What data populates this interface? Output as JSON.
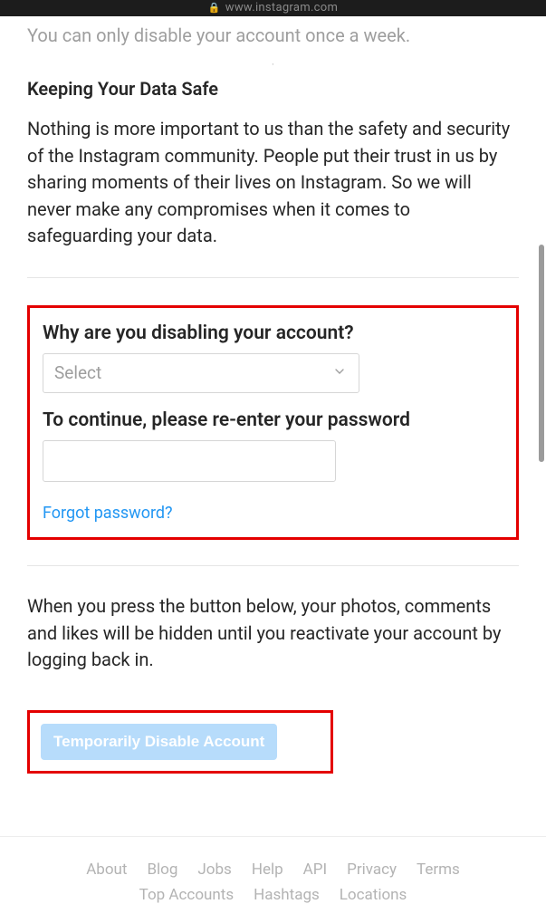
{
  "topbar": {
    "url": "www.instagram.com"
  },
  "intro": {
    "truncated_text": "You can only disable your account once a week."
  },
  "safe": {
    "title": "Keeping Your Data Safe",
    "body": "Nothing is more important to us than the safety and security of the Instagram community. People put their trust in us by sharing moments of their lives on Instagram. So we will never make any compromises when it comes to safeguarding your data."
  },
  "form": {
    "reason_label": "Why are you disabling your account?",
    "select_value": "Select",
    "password_label": "To continue, please re-enter your password",
    "password_value": "",
    "forgot_link": "Forgot password?"
  },
  "confirm": {
    "text": "When you press the button below, your photos, comments and likes will be hidden until you reactivate your account by logging back in.",
    "button": "Temporarily Disable Account"
  },
  "footer": {
    "row1": [
      "About",
      "Blog",
      "Jobs",
      "Help",
      "API",
      "Privacy",
      "Terms"
    ],
    "row2": [
      "Top Accounts",
      "Hashtags",
      "Locations"
    ]
  }
}
